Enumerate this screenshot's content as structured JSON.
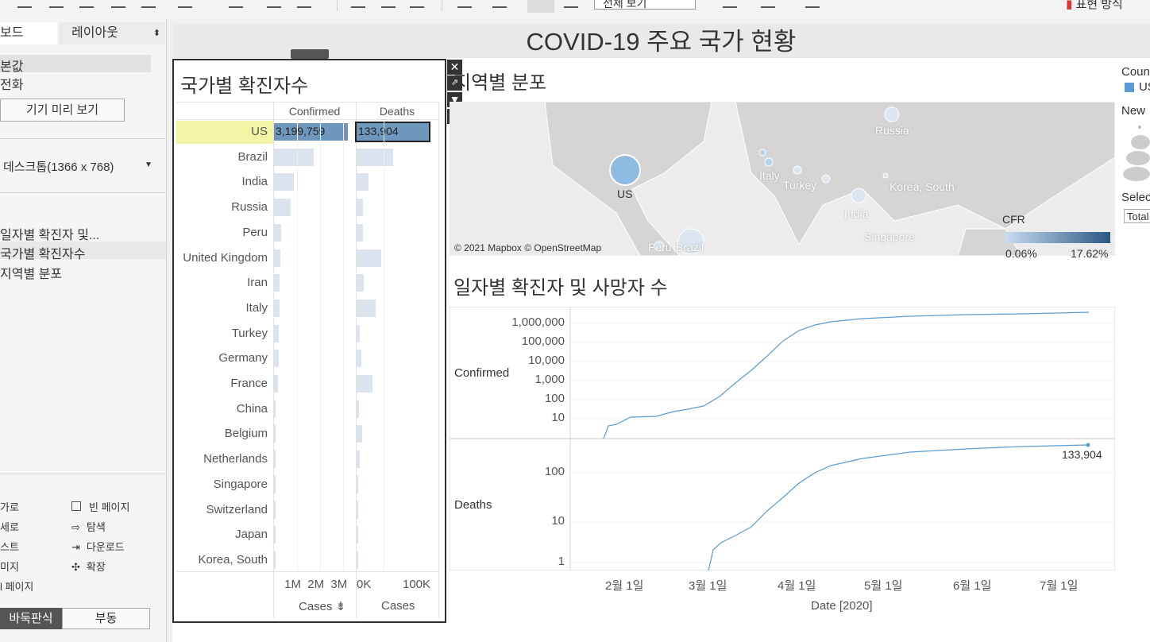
{
  "toolbar": {
    "view_select": "전체 보기",
    "show_me": "표현 방식"
  },
  "left_panel": {
    "tabs": [
      "보드",
      "레이아웃"
    ],
    "device_items": [
      "본값",
      "전화"
    ],
    "preview_button": "기기 미리 보기",
    "size_select": "데스크톱(1366 x 768)",
    "sheets": [
      "일자별 확진자 및...",
      "국가별 확진자수",
      "지역별 분포"
    ],
    "objects_left": [
      "가로",
      "세로",
      "스트",
      "미지",
      "l 페이지"
    ],
    "objects_right": [
      "빈 페이지",
      "탐색",
      "다운로드",
      "확장"
    ],
    "layout_buttons": [
      "바둑판식",
      "부동"
    ]
  },
  "dashboard": {
    "title": "COVID-19 주요 국가 현황"
  },
  "sheet_country": {
    "title": "국가별 확진자수",
    "col_confirmed": "Confirmed",
    "col_deaths": "Deaths",
    "countries": [
      "US",
      "Brazil",
      "India",
      "Russia",
      "Peru",
      "United Kingdom",
      "Iran",
      "Italy",
      "Turkey",
      "Germany",
      "France",
      "China",
      "Belgium",
      "Netherlands",
      "Singapore",
      "Switzerland",
      "Japan",
      "Korea, South"
    ],
    "highlight_confirmed": "3,199,759",
    "highlight_deaths": "133,904",
    "confirmed_values": [
      3199759,
      1713160,
      849553,
      720547,
      319646,
      291373,
      255117,
      242827,
      209962,
      199375,
      170094,
      85427,
      62781,
      51252,
      45961,
      32946,
      21129,
      13417
    ],
    "deaths_values": [
      133904,
      67964,
      22674,
      11205,
      11500,
      44904,
      12829,
      34945,
      5282,
      9071,
      30007,
      4648,
      9782,
      6156,
      26,
      1968,
      982,
      289
    ],
    "confirmed_ticks": [
      "1M",
      "2M",
      "3M"
    ],
    "deaths_ticks": [
      "0K",
      "100K"
    ],
    "axis_title_confirmed": "Cases",
    "axis_title_deaths": "Cases"
  },
  "sheet_map": {
    "title": "지역별 분포",
    "labels": [
      "US",
      "Russia",
      "Italy",
      "Turkey",
      "India",
      "Korea, South",
      "Singapore",
      "Peru",
      "Brazil"
    ],
    "credit": "© 2021 Mapbox © OpenStreetMap",
    "legend_title": "CFR",
    "legend_min": "0.06%",
    "legend_max": "17.62%",
    "legend_color_low": "#c7dcef",
    "legend_color_high": "#2a5783"
  },
  "sheet_line": {
    "title": "일자별 확진자 및 사망자 수",
    "confirmed_label": "Confirmed",
    "deaths_label": "Deaths",
    "confirmed_ticks": [
      "1,000,000",
      "100,000",
      "10,000",
      "1,000",
      "100",
      "10"
    ],
    "deaths_ticks": [
      "100",
      "10",
      "1"
    ],
    "x_ticks": [
      "2월 1일",
      "3월 1일",
      "4월 1일",
      "5월 1일",
      "6월 1일",
      "7월 1일"
    ],
    "x_title": "Date [2020]",
    "end_label": "133,904",
    "line_color": "#5b9bd5"
  },
  "right_legends": {
    "country_title": "Coun",
    "country_item": "US",
    "new_title": "New",
    "select_title": "Selec",
    "select_value": "Total"
  },
  "chart_data": {
    "type": "bar",
    "categories": [
      "US",
      "Brazil",
      "India",
      "Russia",
      "Peru",
      "United Kingdom",
      "Iran",
      "Italy",
      "Turkey",
      "Germany",
      "France",
      "China",
      "Belgium",
      "Netherlands",
      "Singapore",
      "Switzerland",
      "Japan",
      "Korea, South"
    ],
    "series": [
      {
        "name": "Confirmed",
        "values": [
          3199759,
          1713160,
          849553,
          720547,
          319646,
          291373,
          255117,
          242827,
          209962,
          199375,
          170094,
          85427,
          62781,
          51252,
          45961,
          32946,
          21129,
          13417
        ]
      },
      {
        "name": "Deaths",
        "values": [
          133904,
          67964,
          22674,
          11205,
          11500,
          44904,
          12829,
          34945,
          5282,
          9071,
          30007,
          4648,
          9782,
          6156,
          26,
          1968,
          982,
          289
        ]
      }
    ],
    "title": "국가별 확진자수",
    "xlabel": "Cases"
  }
}
